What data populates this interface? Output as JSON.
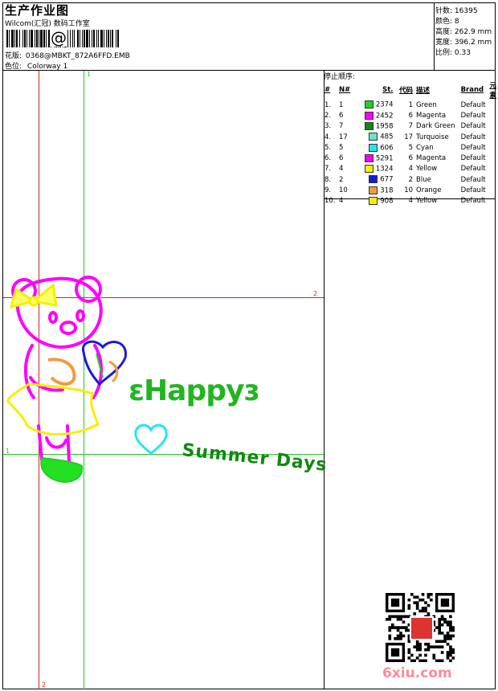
{
  "header": {
    "title": "生产作业图",
    "company": "Wilcom(汇冠) 数码工作室",
    "barcode_char": "@",
    "design_label": "花版:",
    "design_value": "0368@MBKT_872A6FFD.EMB",
    "colorway_label": "色位:",
    "colorway_value": "Colorway 1"
  },
  "stats": [
    {
      "label": "针数:",
      "value": "16395"
    },
    {
      "label": "颜色:",
      "value": "8"
    },
    {
      "label": "高度:",
      "value": "262.9 mm"
    },
    {
      "label": "宽度:",
      "value": "396.2 mm"
    },
    {
      "label": "比例:",
      "value": "0.33"
    }
  ],
  "stop_sequence": {
    "title": "停止顺序:",
    "headers": [
      "#",
      "N#",
      "St.",
      "代码",
      "描述",
      "Brand",
      "元素"
    ],
    "rows": [
      {
        "idx": "1.",
        "n": "1",
        "st": "2374",
        "code": "1",
        "desc": "Green",
        "brand": "Default",
        "color": "#1fd41f"
      },
      {
        "idx": "2.",
        "n": "6",
        "st": "2452",
        "code": "6",
        "desc": "Magenta",
        "brand": "Default",
        "color": "#ff00ff"
      },
      {
        "idx": "3.",
        "n": "7",
        "st": "1958",
        "code": "7",
        "desc": "Dark Green",
        "brand": "Default",
        "color": "#118811"
      },
      {
        "idx": "4.",
        "n": "17",
        "st": "485",
        "code": "17",
        "desc": "Turquoise",
        "brand": "Default",
        "color": "#66e3c8"
      },
      {
        "idx": "5.",
        "n": "5",
        "st": "606",
        "code": "5",
        "desc": "Cyan",
        "brand": "Default",
        "color": "#22e6f0"
      },
      {
        "idx": "6.",
        "n": "6",
        "st": "5291",
        "code": "6",
        "desc": "Magenta",
        "brand": "Default",
        "color": "#ff00ff"
      },
      {
        "idx": "7.",
        "n": "4",
        "st": "1324",
        "code": "4",
        "desc": "Yellow",
        "brand": "Default",
        "color": "#f4f000"
      },
      {
        "idx": "8.",
        "n": "2",
        "st": "677",
        "code": "2",
        "desc": "Blue",
        "brand": "Default",
        "color": "#1a1adb"
      },
      {
        "idx": "9.",
        "n": "10",
        "st": "318",
        "code": "10",
        "desc": "Orange",
        "brand": "Default",
        "color": "#f39a3c"
      },
      {
        "idx": "10.",
        "n": "4",
        "st": "908",
        "code": "4",
        "desc": "Yellow",
        "brand": "Default",
        "color": "#f4f000"
      }
    ]
  },
  "guides": {
    "top_1": "1",
    "right_2": "2",
    "left_1": "1",
    "bottom_2": "2"
  },
  "design_text": {
    "happy": "ɛHappyɜ",
    "summer": "Summer Days"
  },
  "watermark": "6xiu.com",
  "colors": {
    "guide_red": "#e02020",
    "guide_green": "#22cc22"
  }
}
